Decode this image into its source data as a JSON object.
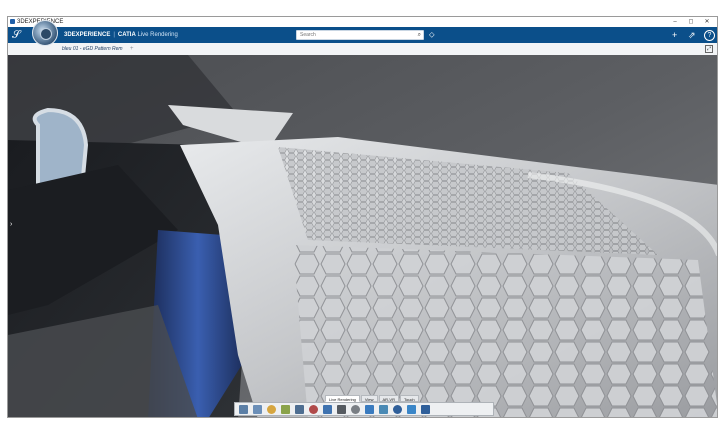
{
  "window": {
    "title": "3DEXPERIENCE",
    "minimize_glyph": "–",
    "maximize_glyph": "◻",
    "close_glyph": "✕"
  },
  "header": {
    "brand_bold": "3DEXPERIENCE",
    "brand_separator": "|",
    "brand_product": "CATIA",
    "brand_app": "Live Rendering",
    "search_placeholder": "Search",
    "search_icon": "⌕",
    "tag_icon": "⬦",
    "add_icon": "+",
    "share_icon": "⇗",
    "help_icon": "?"
  },
  "tabs": {
    "active_label": "bleu 01 - eGD Pattern Rem",
    "add_glyph": "+"
  },
  "viewport": {
    "side_panel_arrow": "›"
  },
  "action_bar": {
    "tabs": [
      "Live Rendering",
      "View",
      "AR-VR",
      "Touch"
    ],
    "active_tab_index": 0,
    "icons": [
      {
        "name": "render-icon",
        "color": "#5b7fa6"
      },
      {
        "name": "environment-icon",
        "color": "#6b8fb8"
      },
      {
        "name": "lights-icon",
        "color": "#d6a640"
      },
      {
        "name": "materials-icon",
        "color": "#8aa34a"
      },
      {
        "name": "camera-icon",
        "color": "#4e6e91"
      },
      {
        "name": "stickers-icon",
        "color": "#b04a4a"
      },
      {
        "name": "turntable-icon",
        "color": "#3f73b0"
      },
      {
        "name": "capture-icon",
        "color": "#555a60"
      },
      {
        "name": "settings-icon",
        "color": "#7a7f85"
      },
      {
        "name": "image-icon",
        "color": "#3a7bbf"
      },
      {
        "name": "export-icon",
        "color": "#4a8ab5"
      },
      {
        "name": "help-icon",
        "color": "#2f5f9a"
      },
      {
        "name": "panel-icon",
        "color": "#3a86c8"
      },
      {
        "name": "share-icon",
        "color": "#2f5f9a"
      }
    ]
  }
}
